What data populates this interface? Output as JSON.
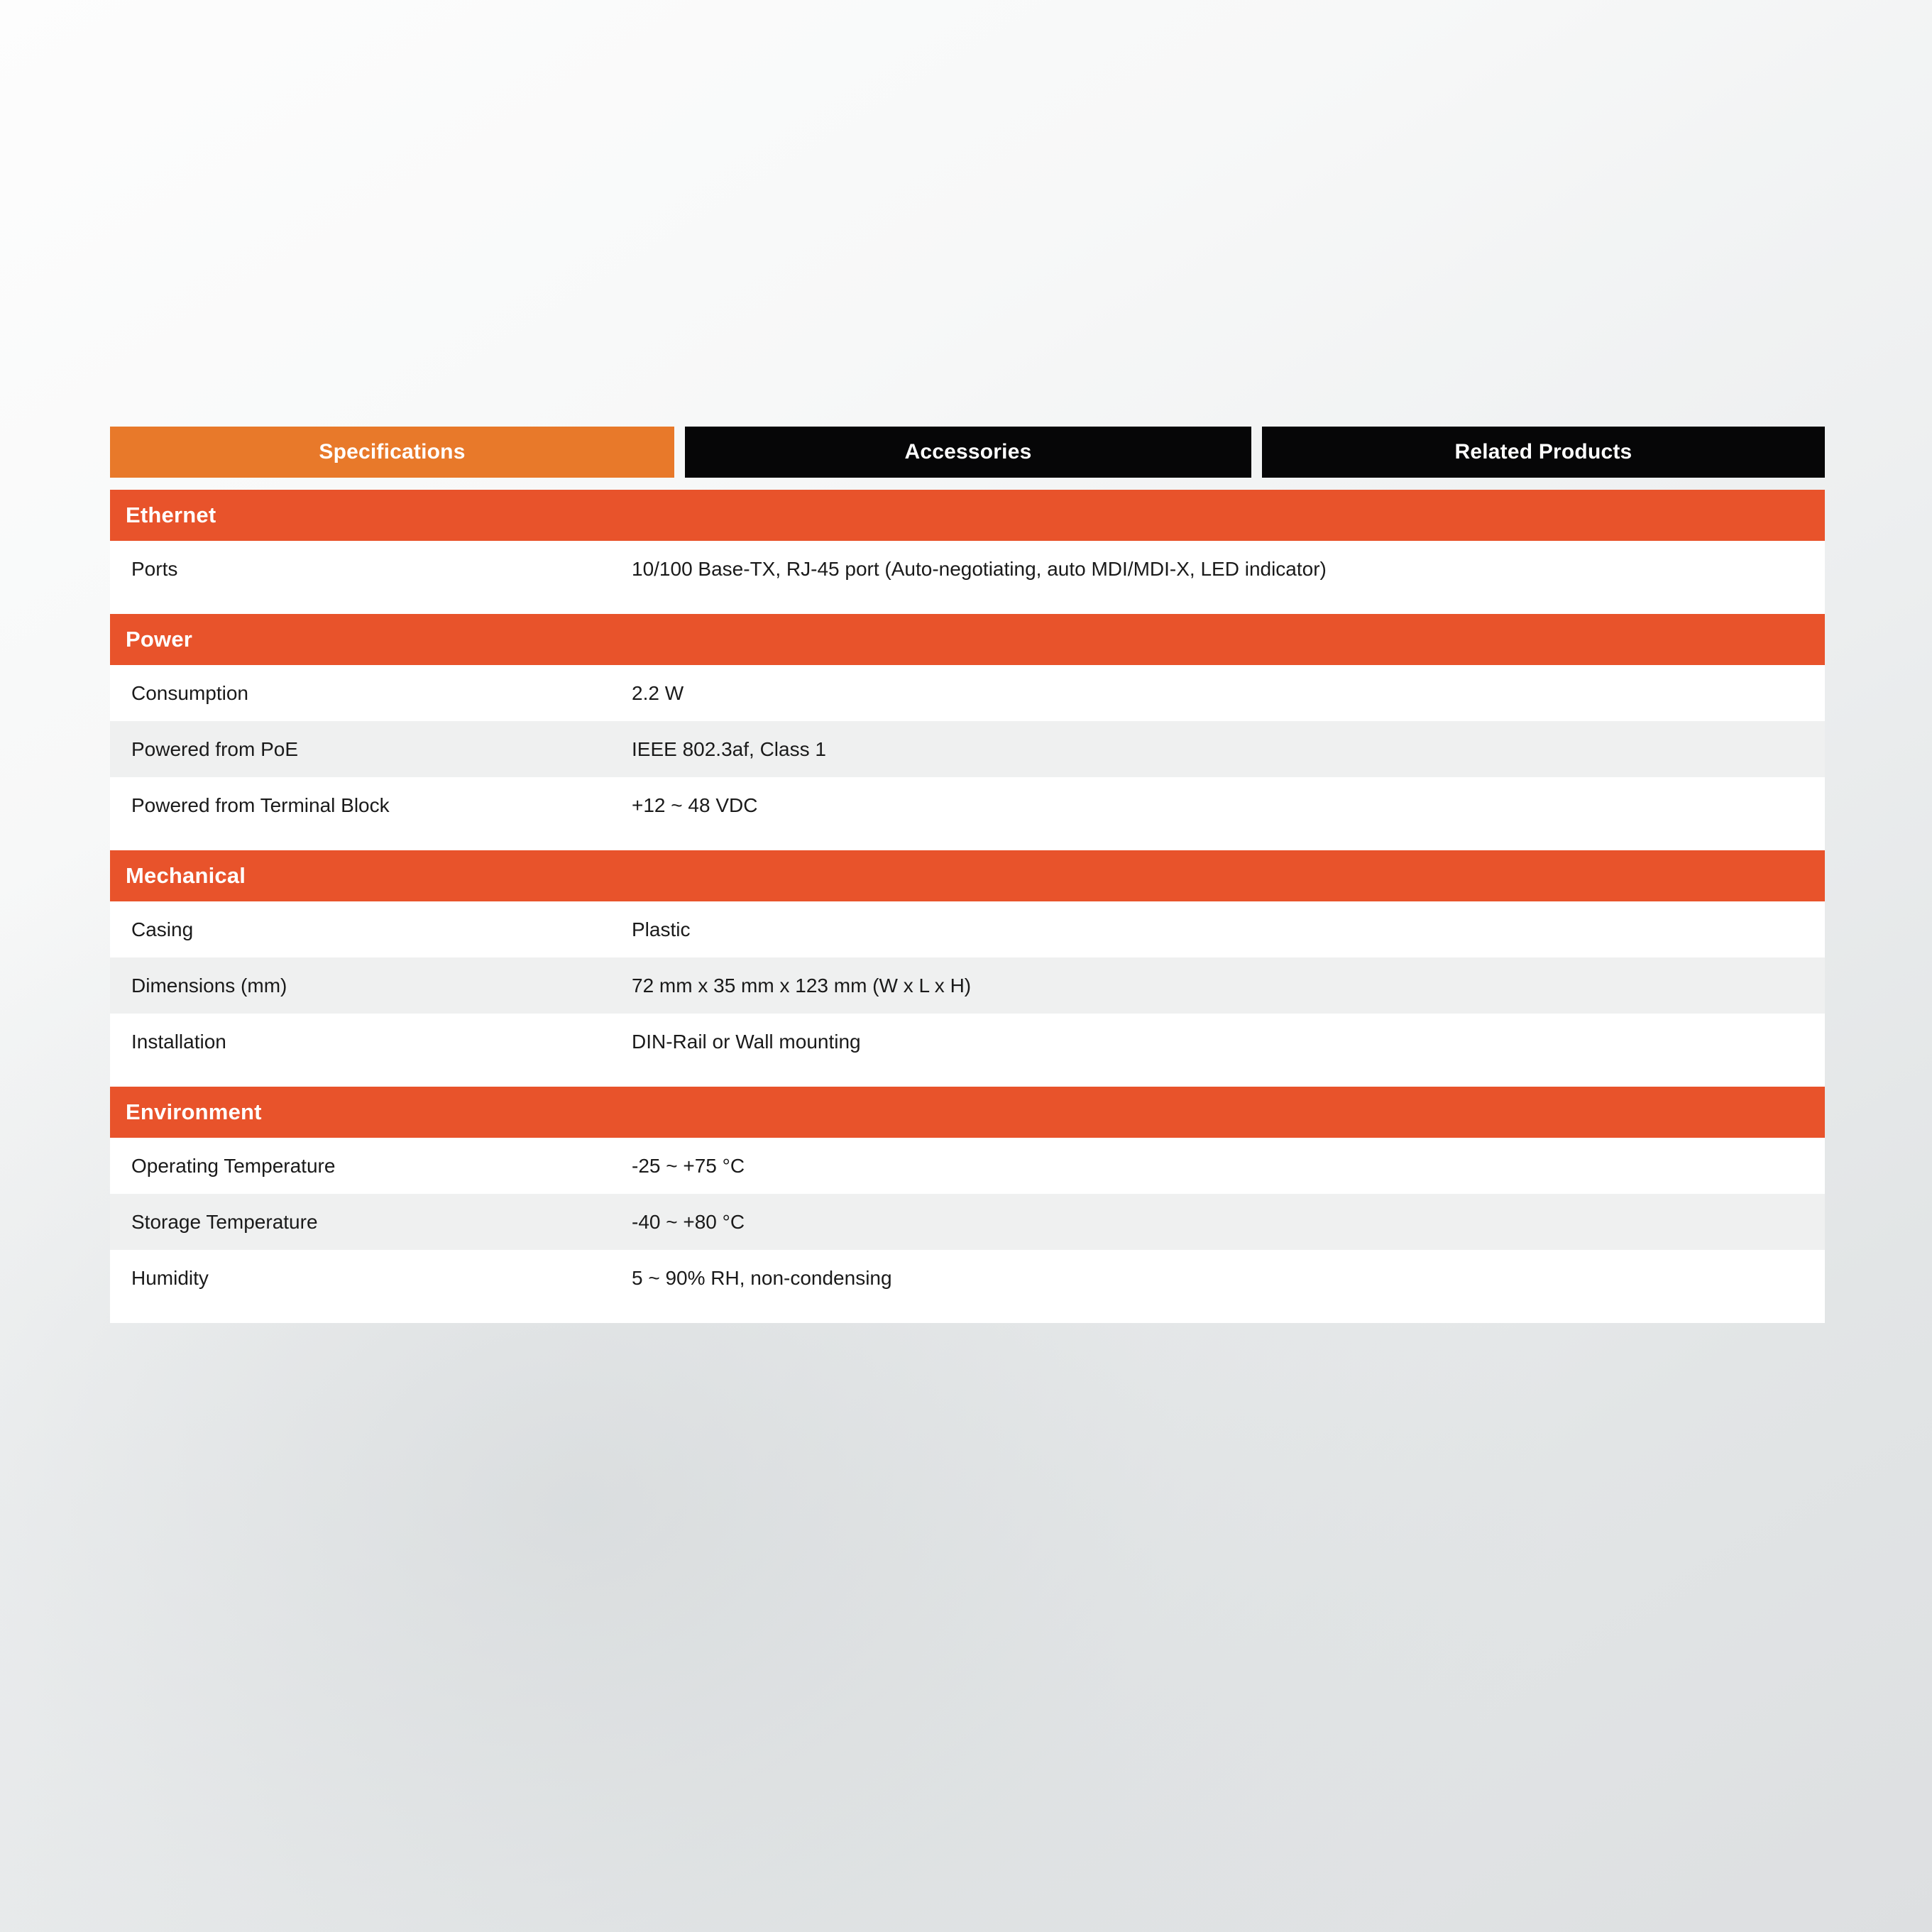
{
  "colors": {
    "tab_active_bg": "#e8792a",
    "tab_inactive_bg": "#060607",
    "section_header_bg": "#e8532b",
    "row_bg": "#ffffff",
    "row_alt_bg": "#eff0f0",
    "text": "#1a1a1a",
    "page_bg": "#e2e5e6"
  },
  "tabs": [
    {
      "label": "Specifications",
      "active": true
    },
    {
      "label": "Accessories",
      "active": false
    },
    {
      "label": "Related Products",
      "active": false
    }
  ],
  "spec_table": {
    "sections": [
      {
        "title": "Ethernet",
        "rows": [
          {
            "label": "Ports",
            "value": "10/100 Base-TX, RJ-45 port (Auto-negotiating, auto MDI/MDI-X, LED indicator)"
          }
        ]
      },
      {
        "title": "Power",
        "rows": [
          {
            "label": "Consumption",
            "value": "2.2 W"
          },
          {
            "label": "Powered from PoE",
            "value": "IEEE 802.3af, Class 1"
          },
          {
            "label": "Powered from Terminal Block",
            "value": "+12 ~ 48 VDC"
          }
        ]
      },
      {
        "title": "Mechanical",
        "rows": [
          {
            "label": "Casing",
            "value": "Plastic"
          },
          {
            "label": "Dimensions (mm)",
            "value": "72 mm x 35 mm x 123 mm (W x L x H)"
          },
          {
            "label": "Installation",
            "value": "DIN-Rail or Wall mounting"
          }
        ]
      },
      {
        "title": "Environment",
        "rows": [
          {
            "label": "Operating Temperature",
            "value": "-25 ~ +75 °C"
          },
          {
            "label": "Storage Temperature",
            "value": "-40 ~ +80 °C"
          },
          {
            "label": "Humidity",
            "value": "5 ~ 90% RH, non-condensing"
          }
        ]
      }
    ]
  }
}
